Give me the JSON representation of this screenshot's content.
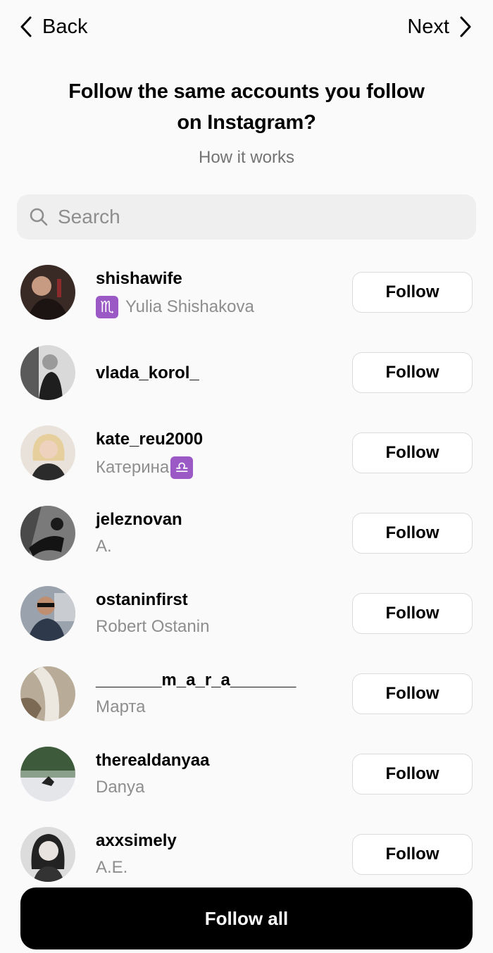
{
  "nav": {
    "back_label": "Back",
    "next_label": "Next"
  },
  "header": {
    "title_line1": "Follow the same accounts you follow",
    "title_line2": "on Instagram?",
    "how_it_works": "How it works"
  },
  "search": {
    "placeholder": "Search",
    "value": ""
  },
  "accounts": [
    {
      "username": "shishawife",
      "full_name": "Yulia Shishakova",
      "badge_lead": "♏",
      "badge_trail": "",
      "button": "Follow"
    },
    {
      "username": "vlada_korol_",
      "full_name": "",
      "badge_lead": "",
      "badge_trail": "",
      "button": "Follow"
    },
    {
      "username": "kate_reu2000",
      "full_name": "Катерина",
      "badge_lead": "",
      "badge_trail": "♎",
      "button": "Follow"
    },
    {
      "username": "jeleznovan",
      "full_name": "A.",
      "badge_lead": "",
      "badge_trail": "",
      "button": "Follow"
    },
    {
      "username": "ostaninfirst",
      "full_name": "Robert Ostanin",
      "badge_lead": "",
      "badge_trail": "",
      "button": "Follow"
    },
    {
      "username": "_______m_a_r_a_______",
      "full_name": "Марта",
      "badge_lead": "",
      "badge_trail": "",
      "button": "Follow"
    },
    {
      "username": "therealdanyaa",
      "full_name": "Danya",
      "badge_lead": "",
      "badge_trail": "",
      "button": "Follow"
    },
    {
      "username": "axxsimely",
      "full_name": "A.E.",
      "badge_lead": "",
      "badge_trail": "",
      "button": "Follow"
    }
  ],
  "footer": {
    "follow_all_label": "Follow all"
  },
  "colors": {
    "badge_purple": "#9b59c6",
    "secondary_text": "#8e8e8e",
    "search_bg": "#efefef"
  }
}
